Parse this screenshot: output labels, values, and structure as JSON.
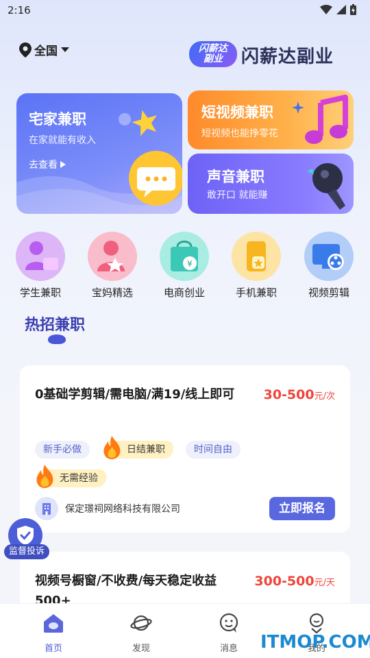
{
  "status_bar": {
    "time": "2:16"
  },
  "header": {
    "location": "全国",
    "brand_badge_line1": "闪薪达",
    "brand_badge_line2": "副业",
    "brand_name": "闪薪达副业"
  },
  "cards": {
    "home": {
      "title": "宅家兼职",
      "subtitle": "在家就能有收入",
      "link": "去查看"
    },
    "video": {
      "title": "短视频兼职",
      "subtitle": "短视频也能挣零花"
    },
    "voice": {
      "title": "声音兼职",
      "subtitle": "敢开口 就能赚"
    }
  },
  "categories": [
    {
      "label": "学生兼职",
      "icon": "student-icon",
      "color": "#d9b3f5"
    },
    {
      "label": "宝妈精选",
      "icon": "mom-icon",
      "color": "#f8b3c4"
    },
    {
      "label": "电商创业",
      "icon": "shopping-bag-icon",
      "color": "#a7ece0"
    },
    {
      "label": "手机兼职",
      "icon": "phone-icon",
      "color": "#fcd98a"
    },
    {
      "label": "视频剪辑",
      "icon": "video-edit-icon",
      "color": "#a9c8f7"
    }
  ],
  "section": {
    "title": "热招兼职"
  },
  "jobs": [
    {
      "title": "0基础学剪辑/需电脑/满19/线上即可",
      "salary": "30-500",
      "unit": "元/次",
      "tags": [
        "新手必做",
        "日结兼职",
        "时间自由",
        "无需经验"
      ],
      "company": "保定璟祠网络科技有限公司",
      "apply": "立即报名"
    },
    {
      "title": "视频号橱窗/不收费/每天稳定收益500+",
      "salary": "300-500",
      "unit": "元/天"
    }
  ],
  "monitor": {
    "label": "监督投诉"
  },
  "tabbar": {
    "items": [
      {
        "label": "首页",
        "active": true
      },
      {
        "label": "发现",
        "active": false
      },
      {
        "label": "消息",
        "active": false
      },
      {
        "label": "我的",
        "active": false
      }
    ]
  },
  "watermark": "ITMOP.COM",
  "colors": {
    "accent": "#4d5bd6",
    "salary": "#f0443a",
    "apply": "#5a68e0"
  }
}
